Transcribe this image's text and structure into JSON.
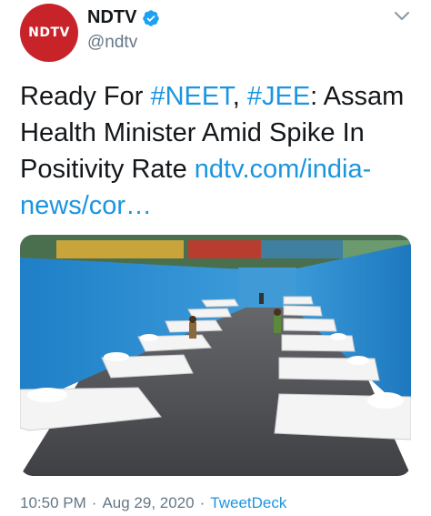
{
  "account": {
    "avatar_text": "NDTV",
    "display_name": "NDTV",
    "handle": "@ndtv",
    "brand_color": "#c9232a",
    "verified_icon": "verified-badge-icon",
    "menu_icon": "chevron-down-icon"
  },
  "tweet": {
    "text_start": "Ready For ",
    "hashtag_1": "#NEET",
    "comma": ", ",
    "hashtag_2": "#JEE",
    "text_mid": ": Assam Health Minister Amid Spike In Positivity Rate ",
    "link_text": "ndtv.com/india-news/cor…",
    "link_color": "#1b95e0"
  },
  "photo": {
    "subject": "rows of beds in covid care facility"
  },
  "meta": {
    "time": "10:50 PM",
    "separator": "·",
    "date": "Aug 29, 2020",
    "source": "TweetDeck"
  }
}
